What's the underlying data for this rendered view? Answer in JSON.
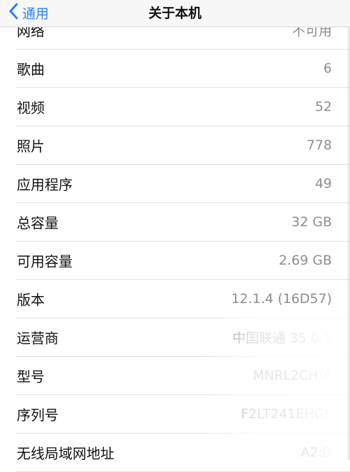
{
  "nav": {
    "back_label": "通用",
    "title": "关于本机"
  },
  "rows": [
    {
      "label": "网络",
      "value": "不可用"
    },
    {
      "label": "歌曲",
      "value": "6"
    },
    {
      "label": "视频",
      "value": "52"
    },
    {
      "label": "照片",
      "value": "778"
    },
    {
      "label": "应用程序",
      "value": "49"
    },
    {
      "label": "总容量",
      "value": "32 GB"
    },
    {
      "label": "可用容量",
      "value": "2.69 GB"
    },
    {
      "label": "版本",
      "value": "12.1.4 (16D57)"
    },
    {
      "label": "运营商",
      "value": "中国联通 35.0.1"
    },
    {
      "label": "型号",
      "value": "MNRL2CH/A"
    },
    {
      "label": "序列号",
      "value": "F2LT241EHGL"
    },
    {
      "label": "无线局域网地址",
      "value": "A2:B"
    }
  ],
  "colors": {
    "accent": "#2f7cf6",
    "value_text": "#8e8e93",
    "separator": "#e1e1e4"
  }
}
